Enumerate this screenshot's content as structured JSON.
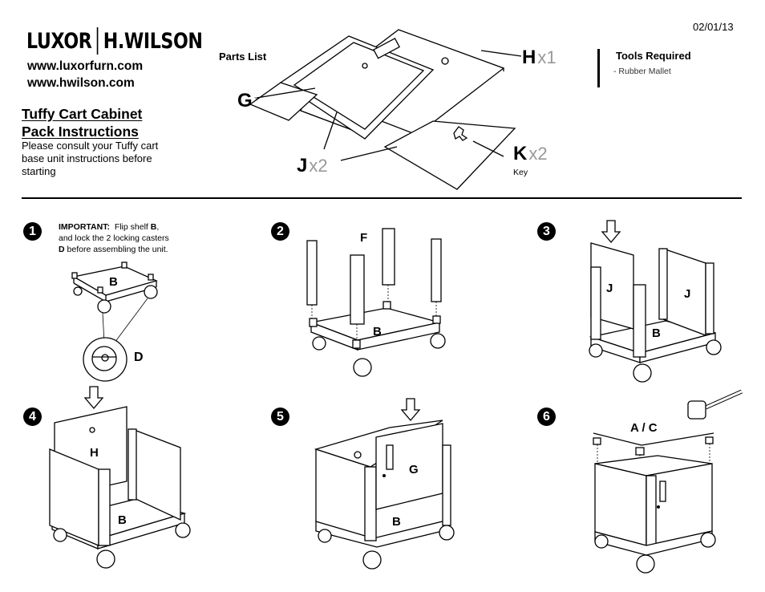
{
  "header": {
    "brand_left": "LUXOR",
    "brand_right": "H.WILSON",
    "urls": [
      "www.luxorfurn.com",
      "www.hwilson.com"
    ],
    "title_lines": [
      "Tuffy Cart Cabinet",
      "Pack Instructions"
    ],
    "intro": "Please consult your Tuffy cart base unit instructions before starting",
    "date": "02/01/13"
  },
  "parts": {
    "heading": "Parts List",
    "items": [
      {
        "letter": "G",
        "qty": "x1",
        "note": ""
      },
      {
        "letter": "H",
        "qty": "x1",
        "note": ""
      },
      {
        "letter": "J",
        "qty": "x2",
        "note": ""
      },
      {
        "letter": "K",
        "qty": "x2",
        "note": "Key"
      }
    ]
  },
  "tools": {
    "heading": "Tools Required",
    "items": [
      "-  Rubber Mallet"
    ]
  },
  "steps": [
    {
      "number": "1",
      "note_bold": "IMPORTANT:",
      "note_parts": [
        "Flip shelf ",
        "B",
        ",\nand lock the 2 locking casters\n",
        "D",
        " before assembling the unit."
      ],
      "labels": [
        "B",
        "D"
      ]
    },
    {
      "number": "2",
      "labels": [
        "F",
        "B"
      ]
    },
    {
      "number": "3",
      "labels": [
        "J",
        "J",
        "B"
      ]
    },
    {
      "number": "4",
      "labels": [
        "H",
        "B"
      ]
    },
    {
      "number": "5",
      "labels": [
        "G",
        "B"
      ]
    },
    {
      "number": "6",
      "labels": [
        "A / C"
      ]
    }
  ]
}
